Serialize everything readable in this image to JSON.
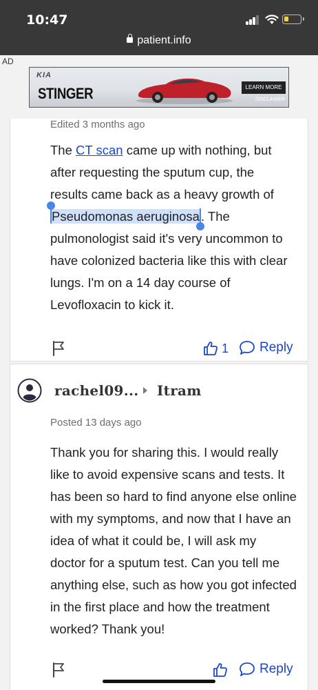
{
  "status_bar": {
    "time": "10:47",
    "url": "patient.info"
  },
  "ad": {
    "label": "AD",
    "brand_logo": "KIA",
    "title": "STINGER",
    "cta": "LEARN MORE",
    "disclaimer": "DISCLAIMER"
  },
  "post1": {
    "meta": "Edited 3 months ago",
    "lines": [
      {
        "before": "The ",
        "link": "CT scan",
        "after": " came up with nothing, but"
      },
      "after requesting the sputum cup, the",
      "results came back as a heavy growth of",
      {
        "selected": "Pseudomonas aeruginosa",
        "after": ". The"
      },
      "pulmonologist said it's very uncommon to",
      "have colonized bacteria like this with clear",
      "lungs. I'm on a 14 day course of",
      "Levofloxacin to kick it."
    ],
    "likes": "1",
    "reply_label": "Reply"
  },
  "post2": {
    "username": "rachel09...",
    "recipient": "Itram",
    "meta": "Posted 13 days ago",
    "lines": [
      "Thank you for sharing this. I would really",
      "like to avoid expensive scans and tests. It",
      "has been so hard to find anyone else online",
      "with my symptoms, and now that I have an",
      "idea of what it could be, I will ask my",
      "doctor for a sputum test. Can you tell me",
      "anything else, such as how you got infected",
      "in the first place and how the treatment",
      "worked? Thank you!"
    ],
    "reply_label": "Reply"
  },
  "colors": {
    "link": "#1a48c4",
    "selection": "#cfe0fb",
    "handle": "#4a86e8"
  },
  "icons": [
    "lock-icon",
    "signal-icon",
    "wifi-icon",
    "battery-icon",
    "flag-icon",
    "thumbs-up-icon",
    "speech-bubble-icon",
    "user-avatar-icon"
  ]
}
